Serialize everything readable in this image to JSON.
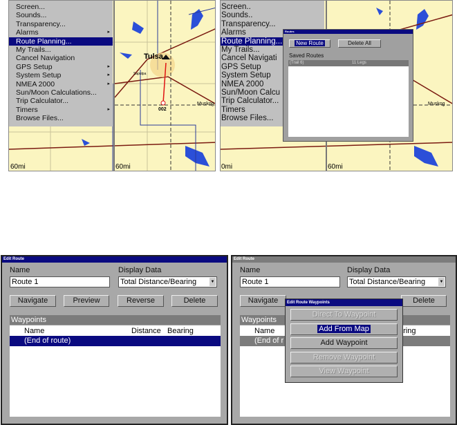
{
  "top_left": {
    "menu": [
      {
        "label": "Screen...",
        "sub": false
      },
      {
        "label": "Sounds...",
        "sub": false
      },
      {
        "label": "Transparency...",
        "sub": false
      },
      {
        "label": "Alarms",
        "sub": true
      },
      {
        "label": "Route Planning...",
        "sub": false,
        "selected": true
      },
      {
        "label": "My Trails...",
        "sub": false
      },
      {
        "label": "Cancel Navigation",
        "sub": false
      },
      {
        "label": "GPS Setup",
        "sub": true
      },
      {
        "label": "System Setup",
        "sub": true
      },
      {
        "label": "NMEA 2000",
        "sub": true
      },
      {
        "label": "Sun/Moon Calculations...",
        "sub": false
      },
      {
        "label": "Trip Calculator...",
        "sub": false
      },
      {
        "label": "Timers",
        "sub": true
      },
      {
        "label": "Browse Files...",
        "sub": false
      }
    ],
    "map": {
      "city": "Tulsa",
      "waypoint": "002",
      "town2": "Muskog",
      "town3": "Sapulpa",
      "scale": "60mi",
      "scale_left": "60mi"
    }
  },
  "top_right": {
    "menu": [
      "Screen..",
      "Sounds..",
      "Transparency...",
      "Alarms",
      "Route Planning...",
      "My Trails...",
      "Cancel Navigati",
      "GPS Setup",
      "System Setup",
      "NMEA 2000",
      "Sun/Moon Calcu",
      "Trip Calculator...",
      "Timers",
      "Browse Files..."
    ],
    "dialog": {
      "title": "Routes",
      "new_route": "New Route",
      "delete_all": "Delete All",
      "saved_label": "Saved Routes",
      "routes": [
        {
          "name": "(Trail 6)",
          "legs": "11 Legs"
        }
      ]
    },
    "map": {
      "town2": "Muskog",
      "scale": "60mi",
      "scale_left": "0mi"
    }
  },
  "edit_route": {
    "title": "Edit Route",
    "name_label": "Name",
    "name_value": "Route 1",
    "display_label": "Display Data",
    "display_value": "Total Distance/Bearing",
    "buttons": [
      "Navigate",
      "Preview",
      "Reverse",
      "Delete"
    ],
    "waypoints_label": "Waypoints",
    "columns": [
      "Name",
      "Distance",
      "Bearing"
    ],
    "rows": [
      "(End of route)"
    ]
  },
  "edit_route_right": {
    "title": "Edit Route",
    "name_label": "Name",
    "name_value": "Route 1",
    "display_label": "Display Data",
    "display_value": "Total Distance/Bearing",
    "navigate": "Navigate",
    "delete": "Delete",
    "waypoints_label": "Waypoints",
    "col_name": "Name",
    "col_bearing_partial": "aring",
    "row_partial": "(End of r",
    "popup": {
      "title": "Edit Route Waypoints",
      "items": [
        {
          "label": "Direct To Waypoint",
          "enabled": false
        },
        {
          "label": "Add From Map",
          "enabled": true,
          "selected": true
        },
        {
          "label": "Add Waypoint",
          "enabled": true
        },
        {
          "label": "Remove Waypoint",
          "enabled": false
        },
        {
          "label": "View Waypoint",
          "enabled": false
        }
      ]
    }
  },
  "colors": {
    "accent": "#0a0a80",
    "panel": "#a8a8a8",
    "map": "#fbf5c0",
    "water": "#2b4fd8",
    "road": "#7a1a10"
  }
}
